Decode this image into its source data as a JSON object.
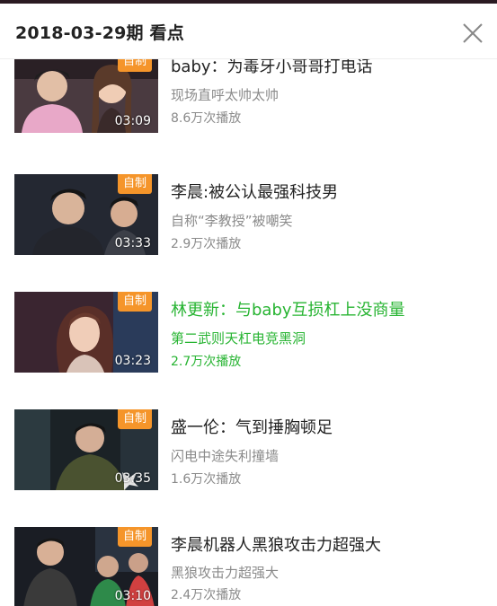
{
  "header": {
    "title": "2018-03-29期 看点",
    "close_icon": "close-icon"
  },
  "accent_color": "#27b432",
  "badge_color": "#f5952a",
  "videos": [
    {
      "badge": "自制",
      "duration": "03:09",
      "title": "baby：为毒牙小哥哥打电话",
      "subtitle": "现场直呼太帅太帅",
      "plays": "8.6万次播放",
      "active": false
    },
    {
      "badge": "自制",
      "duration": "03:33",
      "title": "李晨:被公认最强科技男",
      "subtitle": "自称“李教授”被嘲笑",
      "plays": "2.9万次播放",
      "active": false
    },
    {
      "badge": "自制",
      "duration": "03:23",
      "title": "林更新：与baby互损杠上没商量",
      "subtitle": "第二武则天杠电竞黑洞",
      "plays": "2.7万次播放",
      "active": true
    },
    {
      "badge": "自制",
      "duration": "03:35",
      "title": "盛一伦：气到捶胸顿足",
      "subtitle": "闪电中途失利撞墙",
      "plays": "1.6万次播放",
      "active": false
    },
    {
      "badge": "自制",
      "duration": "03:10",
      "title": "李晨机器人黑狼攻击力超强大",
      "subtitle": "黑狼攻击力超强大",
      "plays": "2.4万次播放",
      "active": false
    }
  ]
}
